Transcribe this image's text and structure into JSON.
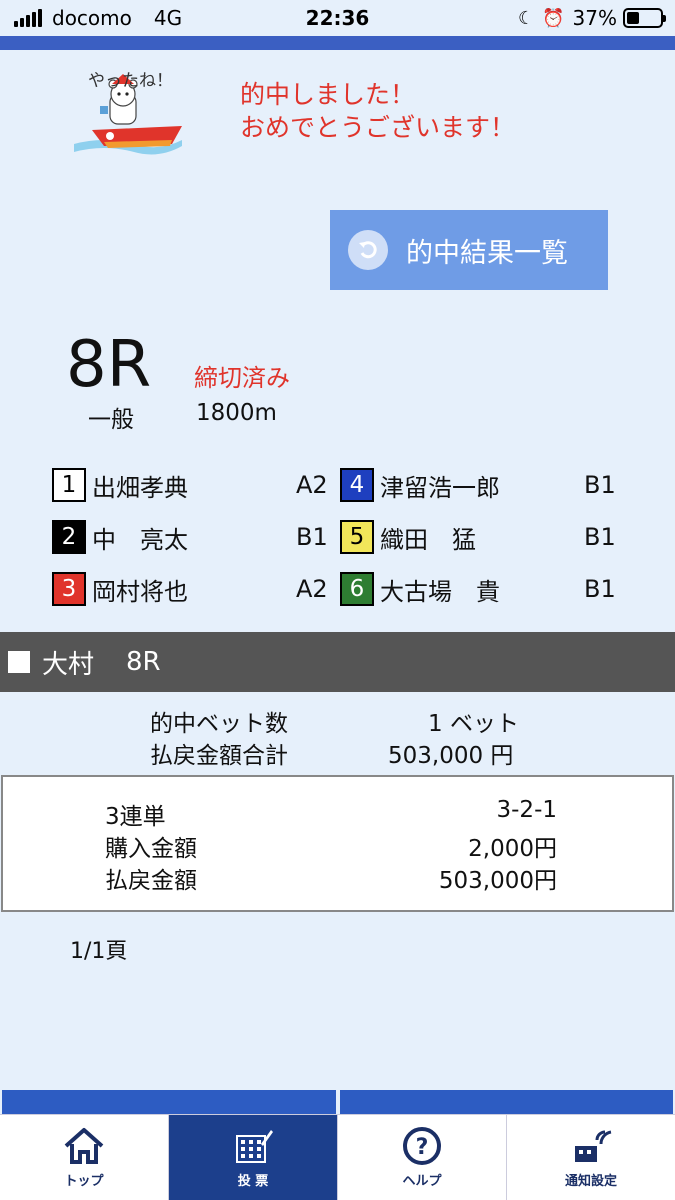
{
  "status_bar": {
    "carrier": "docomo",
    "network": "4G",
    "time": "22:36",
    "battery": "37%",
    "battery_level": 0.37
  },
  "banner": {
    "mascot_text": "やったね！",
    "line1": "的中しました！",
    "line2": "おめでとうございます！"
  },
  "result_button": {
    "label": "的中結果一覧"
  },
  "race": {
    "number": "8R",
    "status": "締切済み",
    "class": "一般",
    "distance": "1800m"
  },
  "racers": [
    {
      "lane": "1",
      "name": "出畑孝典",
      "rank": "A2",
      "color": "#ffffff",
      "text_color": "#000000"
    },
    {
      "lane": "2",
      "name": "中　亮太",
      "rank": "B1",
      "color": "#000000",
      "text_color": "#ffffff"
    },
    {
      "lane": "3",
      "name": "岡村将也",
      "rank": "A2",
      "color": "#e0342b",
      "text_color": "#ffffff"
    },
    {
      "lane": "4",
      "name": "津留浩一郎",
      "rank": "B1",
      "color": "#1e3fbf",
      "text_color": "#ffffff"
    },
    {
      "lane": "5",
      "name": "織田　猛",
      "rank": "B1",
      "color": "#f2e65a",
      "text_color": "#000000"
    },
    {
      "lane": "6",
      "name": "大古場　貴",
      "rank": "B1",
      "color": "#2e7d32",
      "text_color": "#ffffff"
    }
  ],
  "venue": {
    "name": "大村",
    "race": "8R"
  },
  "summary": {
    "hit_count_label": "的中ベット数",
    "hit_count_value": "1 ベット",
    "payout_total_label": "払戻金額合計",
    "payout_total_value": "503,000 円"
  },
  "bet": {
    "type_label": "3連単",
    "combination": "3-2-1",
    "purchase_label": "購入金額",
    "purchase_value": "2,000円",
    "payout_label": "払戻金額",
    "payout_value": "503,000円"
  },
  "page_indicator": "1/1頁",
  "tabs": [
    {
      "label": "トップ",
      "icon": "home-icon",
      "active": false
    },
    {
      "label": "投 票",
      "icon": "vote-icon",
      "active": true
    },
    {
      "label": "ヘルプ",
      "icon": "help-icon",
      "active": false
    },
    {
      "label": "通知設定",
      "icon": "notification-settings-icon",
      "active": false
    }
  ],
  "colors": {
    "accent": "#e0342b",
    "button": "#6f9ce6",
    "header": "#3b5fc2",
    "tab_active": "#1c3f8c"
  }
}
